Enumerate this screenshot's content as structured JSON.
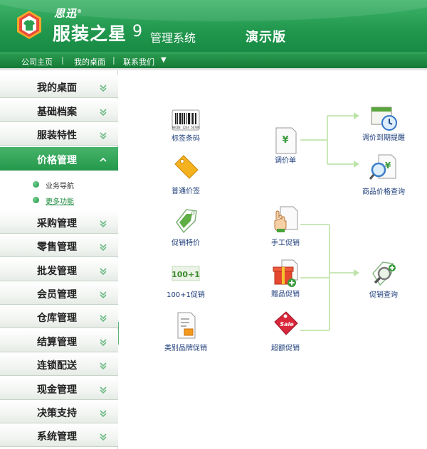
{
  "header": {
    "brand_small": "思迅",
    "brand_mark": "®",
    "product_name": "服装之星",
    "version": "9",
    "system_label": "管理系统",
    "edition": "演示版"
  },
  "navbar": {
    "items": [
      "公司主页",
      "我的桌面",
      "联系我们"
    ],
    "separator": "|",
    "dropdown_glyph": "▼"
  },
  "sidebar": {
    "items": [
      {
        "label": "我的桌面"
      },
      {
        "label": "基础档案"
      },
      {
        "label": "服装特性"
      },
      {
        "label": "价格管理"
      },
      {
        "label": "采购管理"
      },
      {
        "label": "零售管理"
      },
      {
        "label": "批发管理"
      },
      {
        "label": "会员管理"
      },
      {
        "label": "仓库管理"
      },
      {
        "label": "结算管理"
      },
      {
        "label": "连锁配送"
      },
      {
        "label": "现金管理"
      },
      {
        "label": "决策支持"
      },
      {
        "label": "系统管理"
      }
    ],
    "active_index": 3,
    "submenu": [
      "业务导航",
      "更多功能"
    ]
  },
  "main": {
    "nodes": {
      "barcode": {
        "label": "标签条码",
        "icon": "barcode-icon",
        "art": "ABCDE 1234 56789"
      },
      "price_tag": {
        "label": "普通价签",
        "icon": "price-tag-icon"
      },
      "promo_price": {
        "label": "促销特价",
        "icon": "promo-tag-icon"
      },
      "promo_100": {
        "label": "100+1促销",
        "icon": "plus-one-icon",
        "art": "100+1"
      },
      "brand_promo": {
        "label": "类别品牌促销",
        "icon": "category-doc-icon"
      },
      "adjust_sheet": {
        "label": "调价单",
        "icon": "yen-doc-icon",
        "art": "¥"
      },
      "manual_promo": {
        "label": "手工促销",
        "icon": "hand-doc-icon"
      },
      "gift_promo": {
        "label": "赠品促销",
        "icon": "gift-icon"
      },
      "amount_promo": {
        "label": "超额促销",
        "icon": "sale-tag-icon",
        "art": "Sale"
      },
      "adjust_remind": {
        "label": "调价到期提醒",
        "icon": "clock-calendar-icon"
      },
      "price_query": {
        "label": "商品价格查询",
        "icon": "yen-search-icon",
        "art": "¥"
      },
      "promo_query": {
        "label": "促销查询",
        "icon": "magnifier-tag-icon"
      }
    }
  },
  "colors": {
    "brand_green": "#22994f",
    "nav_green": "#147a36",
    "flow_line": "#c9e8b8",
    "caption_blue": "#1d3d7a"
  }
}
